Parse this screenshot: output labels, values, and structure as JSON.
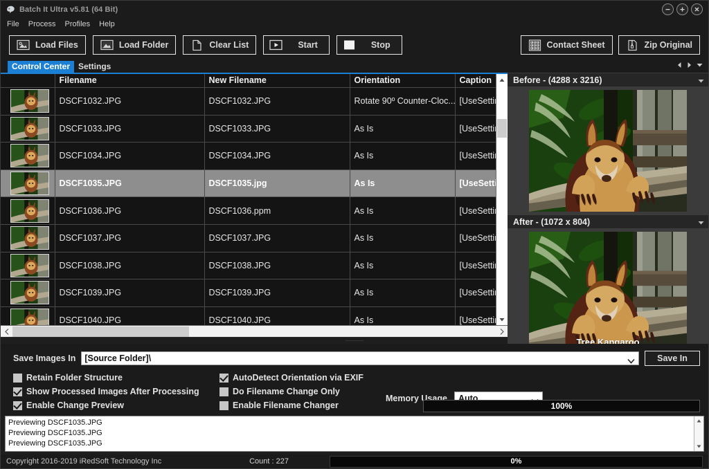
{
  "window": {
    "title": "Batch It Ultra v5.81 (64 Bit)",
    "logo_icon": "app-logo-icon",
    "minimize_icon": "minimize-icon",
    "maximize_icon": "maximize-icon",
    "close_icon": "close-icon"
  },
  "menu": {
    "items": [
      {
        "label": "File"
      },
      {
        "label": "Process"
      },
      {
        "label": "Profiles"
      },
      {
        "label": "Help"
      }
    ]
  },
  "toolbar": {
    "left": [
      {
        "label": "Load Files",
        "icon": "load-files-icon"
      },
      {
        "label": "Load Folder",
        "icon": "load-folder-icon"
      },
      {
        "label": "Clear List",
        "icon": "page-icon"
      },
      {
        "label": "Start",
        "icon": "play-icon"
      },
      {
        "label": "Stop",
        "icon": "stop-icon"
      }
    ],
    "right": [
      {
        "label": "Contact Sheet",
        "icon": "contact-sheet-icon"
      },
      {
        "label": "Zip Original",
        "icon": "zip-icon"
      }
    ]
  },
  "tabs": {
    "items": [
      {
        "label": "Control Center",
        "active": true
      },
      {
        "label": "Settings",
        "active": false
      }
    ],
    "nav": {
      "prev_icon": "triangle-left-icon",
      "next_icon": "triangle-right-icon",
      "menu_icon": "triangle-down-icon"
    }
  },
  "filelist": {
    "columns": [
      "",
      "Filename",
      "New Filename",
      "Orientation",
      "Caption"
    ],
    "rows": [
      {
        "thumb": "t1",
        "filename": "DSCF1032.JPG",
        "new_filename": "DSCF1032.JPG",
        "orientation": "Rotate 90º Counter-Cloc...",
        "caption": "[UseSettin",
        "selected": false
      },
      {
        "thumb": "t2",
        "filename": "DSCF1033.JPG",
        "new_filename": "DSCF1033.JPG",
        "orientation": "As Is",
        "caption": "[UseSettin",
        "selected": false
      },
      {
        "thumb": "t3",
        "filename": "DSCF1034.JPG",
        "new_filename": "DSCF1034.JPG",
        "orientation": "As Is",
        "caption": "[UseSettin",
        "selected": false
      },
      {
        "thumb": "t4",
        "filename": "DSCF1035.JPG",
        "new_filename": "DSCF1035.jpg",
        "orientation": "As Is",
        "caption": "[UseSettin",
        "selected": true
      },
      {
        "thumb": "t5",
        "filename": "DSCF1036.JPG",
        "new_filename": "DSCF1036.ppm",
        "orientation": "As Is",
        "caption": "[UseSettin",
        "selected": false
      },
      {
        "thumb": "t6",
        "filename": "DSCF1037.JPG",
        "new_filename": "DSCF1037.JPG",
        "orientation": "As Is",
        "caption": "[UseSettin",
        "selected": false
      },
      {
        "thumb": "t7",
        "filename": "DSCF1038.JPG",
        "new_filename": "DSCF1038.JPG",
        "orientation": "As Is",
        "caption": "[UseSettin",
        "selected": false
      },
      {
        "thumb": "t8",
        "filename": "DSCF1039.JPG",
        "new_filename": "DSCF1039.JPG",
        "orientation": "As Is",
        "caption": "[UseSettin",
        "selected": false
      },
      {
        "thumb": "t9",
        "filename": "DSCF1040.JPG",
        "new_filename": "DSCF1040.JPG",
        "orientation": "As Is",
        "caption": "[UseSettin",
        "selected": false
      }
    ]
  },
  "preview": {
    "before": {
      "title": "Before - (4288 x 3216)",
      "caret_icon": "chevron-down-icon"
    },
    "after": {
      "title": "After - (1072 x 804)",
      "caption_overlay": "Tree Kangaroo",
      "caret_icon": "chevron-down-icon"
    }
  },
  "options": {
    "save_images_in_label": "Save Images In",
    "save_path_value": "[Source Folder]\\",
    "save_in_button": "Save In",
    "checkboxes_left": [
      {
        "label": "Retain Folder Structure",
        "checked": false
      },
      {
        "label": "Show Processed Images After Processing",
        "checked": true
      },
      {
        "label": "Enable Change Preview",
        "checked": true
      }
    ],
    "checkboxes_right": [
      {
        "label": "AutoDetect Orientation via EXIF",
        "checked": true
      },
      {
        "label": "Do Filename Change Only",
        "checked": false
      },
      {
        "label": "Enable Filename Changer",
        "checked": false
      }
    ],
    "memory_usage_label": "Memory Usage",
    "memory_usage_value": "Auto",
    "memory_progress_text": "100%"
  },
  "log": {
    "lines": [
      "Previewing DSCF1035.JPG",
      "Previewing DSCF1035.JPG",
      "Previewing DSCF1035.JPG"
    ]
  },
  "statusbar": {
    "copyright": "Copyright 2016-2019 iRedSoft Technology Inc",
    "count": "Count : 227",
    "progress_text": "0%"
  },
  "colors": {
    "accent": "#1b7fd4",
    "window_bg": "#1b1b1b",
    "panel_bg": "#1e1e1e",
    "selected_row": "#8e8e8e",
    "text": "#e2e2e2"
  }
}
